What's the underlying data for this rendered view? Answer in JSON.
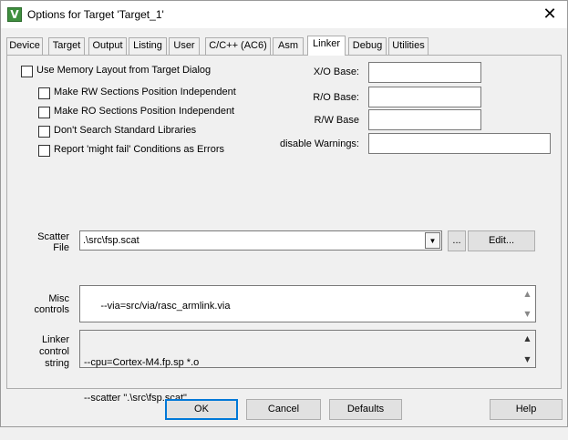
{
  "window": {
    "title": "Options for Target 'Target_1'",
    "icon_label": "V",
    "close_glyph": "✕"
  },
  "tabs": [
    {
      "label": "Device"
    },
    {
      "label": "Target"
    },
    {
      "label": "Output"
    },
    {
      "label": "Listing"
    },
    {
      "label": "User"
    },
    {
      "label": "C/C++ (AC6)"
    },
    {
      "label": "Asm"
    },
    {
      "label": "Linker",
      "active": true
    },
    {
      "label": "Debug"
    },
    {
      "label": "Utilities"
    }
  ],
  "linker": {
    "options": {
      "use_memory_layout": {
        "label": "Use Memory Layout from Target Dialog",
        "checked": false
      },
      "rw_independent": {
        "label": "Make RW Sections Position Independent",
        "checked": false
      },
      "ro_independent": {
        "label": "Make RO Sections Position Independent",
        "checked": false
      },
      "no_std_libs": {
        "label": "Don't Search Standard Libraries",
        "checked": false
      },
      "might_fail_errors": {
        "label": "Report 'might fail' Conditions as Errors",
        "checked": false
      }
    },
    "xo_base": {
      "label": "X/O Base:",
      "value": ""
    },
    "ro_base": {
      "label": "R/O Base:",
      "value": ""
    },
    "rw_base": {
      "label": "R/W Base",
      "value": ""
    },
    "disable_warnings": {
      "label": "disable Warnings:",
      "value": ""
    },
    "scatter_file": {
      "label_line1": "Scatter",
      "label_line2": "File",
      "value": ".\\src\\fsp.scat",
      "arrow": "▼",
      "browse_label": "...",
      "edit_label": "Edit..."
    },
    "misc_controls": {
      "label_line1": "Misc",
      "label_line2": "controls",
      "value": "--via=src/via/rasc_armlink.via"
    },
    "linker_control": {
      "label_line1": "Linker",
      "label_line2": "control",
      "label_line3": "string",
      "line1": "--cpu=Cortex-M4.fp.sp *.o",
      "line2": "--scatter \".\\src\\fsp.scat\""
    }
  },
  "buttons": {
    "ok": "OK",
    "cancel": "Cancel",
    "defaults": "Defaults",
    "help": "Help"
  },
  "scroll_glyphs": {
    "up": "▲",
    "down": "▼"
  }
}
